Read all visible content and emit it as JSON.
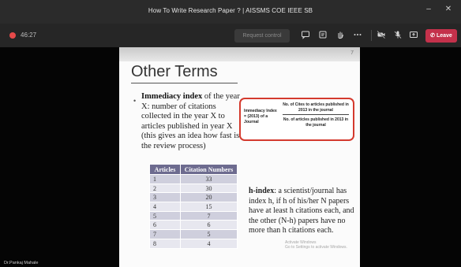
{
  "window": {
    "title": "How To Write Research Paper ? | AISSMS COE IEEE SB",
    "minimize_glyph": "–",
    "close_glyph": "✕"
  },
  "toolbar": {
    "timer": "46:27",
    "request_control_label": "Request control",
    "leave_label": "Leave",
    "icons": [
      "chat-icon",
      "reactions-icon",
      "raise-hand-icon",
      "more-icon",
      "camera-off-icon",
      "mic-off-icon",
      "share-icon"
    ]
  },
  "slide": {
    "number": "7",
    "title": "Other Terms",
    "bullet_glyph": "•",
    "immediacy_term": "Immediacy index",
    "immediacy_text": " of the year X: number of citations collected in the year X to articles published in year X (this gives an idea how fast is the review process)",
    "formula": {
      "lhs": "Immediacy Index = (2013) of a Journal",
      "numerator": "No. of Cites to articles published in 2013 in the journal",
      "denominator": "No. of articles published in 2013 in the journal"
    },
    "table": {
      "headers": [
        "Articles",
        "Citation Numbers"
      ],
      "rows": [
        [
          "1",
          "33"
        ],
        [
          "2",
          "30"
        ],
        [
          "3",
          "20"
        ],
        [
          "4",
          "15"
        ],
        [
          "5",
          "7"
        ],
        [
          "6",
          "6"
        ],
        [
          "7",
          "5"
        ],
        [
          "8",
          "4"
        ]
      ]
    },
    "hindex_term": "h-index",
    "hindex_text": ": a scientist/journal has index h, if h of his/her N papers have at least h citations each, and the other (N-h) papers have no more than h citations each.",
    "watermark_line1": "Activate Windows",
    "watermark_line2": "Go to Settings to activate Windows."
  },
  "speaker_name": "Dr.Pankaj Mahale",
  "colors": {
    "leave": "#c4314b",
    "formula_border": "#d43a2e",
    "table_header": "#6d6b8f"
  }
}
